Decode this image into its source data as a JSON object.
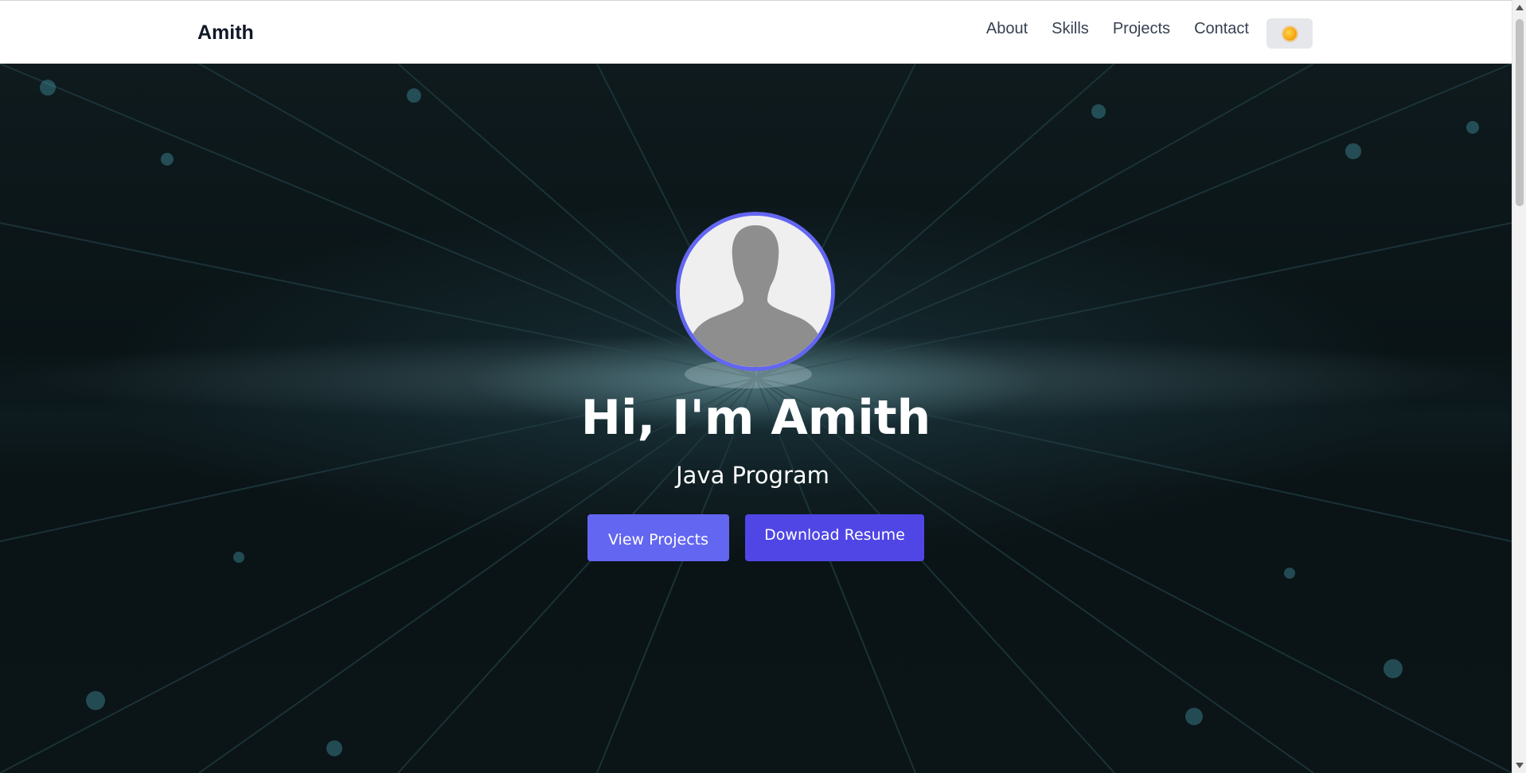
{
  "navbar": {
    "brand": "Amith",
    "links": [
      "About",
      "Skills",
      "Projects",
      "Contact"
    ],
    "theme_toggle_icon": "sun-icon"
  },
  "hero": {
    "avatar_icon": "user-silhouette-icon",
    "title": "Hi, I'm Amith",
    "subtitle": "Java Program",
    "buttons": {
      "view_projects": "View Projects",
      "download_resume": "Download Resume"
    }
  },
  "colors": {
    "accent": "#6366f1",
    "accent_dark": "#4f46e5",
    "navbar_bg": "#ffffff",
    "hero_bg": "#0b1417",
    "sun": "#f59e0b"
  }
}
